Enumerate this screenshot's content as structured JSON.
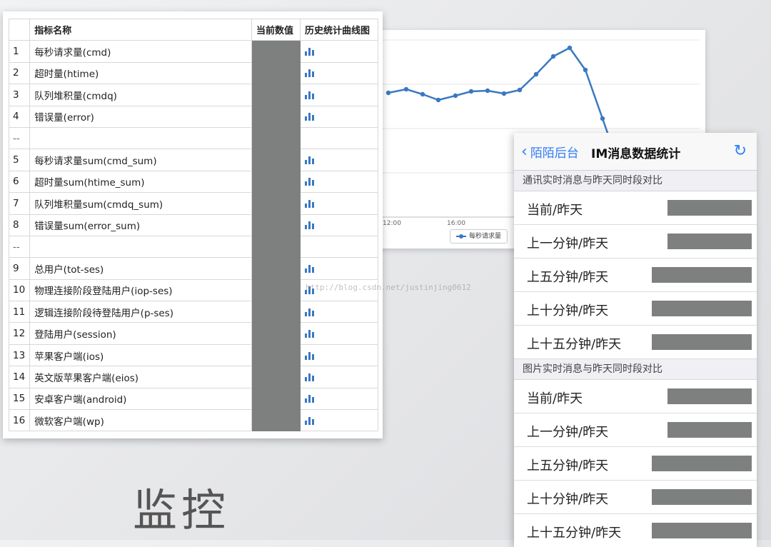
{
  "chart_card": {
    "x_ticks": [
      "12:00",
      "16:00"
    ],
    "legend": "每秒请求量",
    "series_color": "#3a78c2"
  },
  "table": {
    "headers": [
      "",
      "指标名称",
      "当前数值",
      "历史统计曲线图"
    ],
    "rows": [
      {
        "idx": "1",
        "name": "每秒请求量(cmd)"
      },
      {
        "idx": "2",
        "name": "超时量(htime)"
      },
      {
        "idx": "3",
        "name": "队列堆积量(cmdq)"
      },
      {
        "idx": "4",
        "name": "错误量(error)"
      },
      {
        "sep": true,
        "idx": "--",
        "name": ""
      },
      {
        "idx": "5",
        "name": "每秒请求量sum(cmd_sum)"
      },
      {
        "idx": "6",
        "name": "超时量sum(htime_sum)"
      },
      {
        "idx": "7",
        "name": "队列堆积量sum(cmdq_sum)"
      },
      {
        "idx": "8",
        "name": "错误量sum(error_sum)"
      },
      {
        "sep": true,
        "idx": "--",
        "name": ""
      },
      {
        "idx": "9",
        "name": "总用户(tot-ses)"
      },
      {
        "idx": "10",
        "name": "物理连接阶段登陆用户(iop-ses)"
      },
      {
        "idx": "11",
        "name": "逻辑连接阶段待登陆用户(p-ses)"
      },
      {
        "idx": "12",
        "name": "登陆用户(session)"
      },
      {
        "idx": "13",
        "name": "苹果客户端(ios)"
      },
      {
        "idx": "14",
        "name": "英文版苹果客户端(eios)"
      },
      {
        "idx": "15",
        "name": "安卓客户端(android)"
      },
      {
        "idx": "16",
        "name": "微软客户端(wp)"
      }
    ],
    "accent_color": "#3a78c2",
    "mask_color": "#7e807f"
  },
  "watermark": "http://blog.csdn.net/justinjing0612",
  "big_title": "监控",
  "phone": {
    "back_label": "陌陌后台",
    "title": "IM消息数据统计",
    "accent_color": "#2f7df6",
    "sections": [
      {
        "header": "通讯实时消息与昨天同时段对比",
        "rows": [
          "当前/昨天",
          "上一分钟/昨天",
          "上五分钟/昨天",
          "上十分钟/昨天",
          "上十五分钟/昨天"
        ]
      },
      {
        "header": "图片实时消息与昨天同时段对比",
        "rows": [
          "当前/昨天",
          "上一分钟/昨天",
          "上五分钟/昨天",
          "上十分钟/昨天",
          "上十五分钟/昨天"
        ]
      }
    ]
  }
}
